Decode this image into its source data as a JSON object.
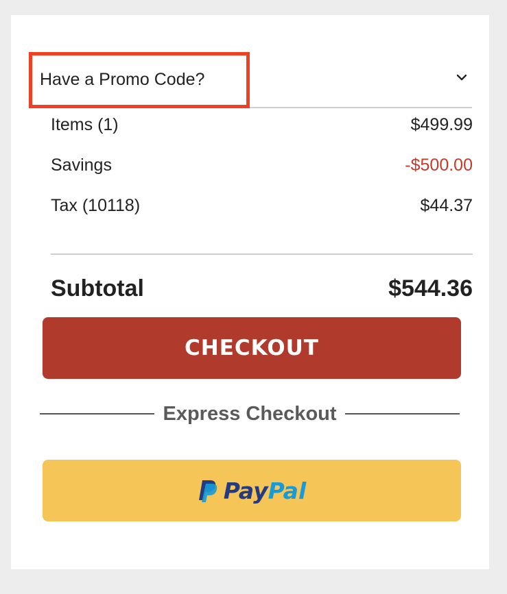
{
  "promo": {
    "label": "Have a Promo Code?",
    "icon": "chevron-down-icon"
  },
  "summary": {
    "items_label": "Items (1)",
    "items_value": "$499.99",
    "savings_label": "Savings",
    "savings_value": "-$500.00",
    "tax_label": "Tax (10118)",
    "tax_value": "$44.37"
  },
  "subtotal": {
    "label": "Subtotal",
    "value": "$544.36"
  },
  "checkout": {
    "label": "CHECKOUT"
  },
  "express": {
    "label": "Express Checkout"
  },
  "paypal": {
    "text_part1": "Pay",
    "text_part2": "Pal",
    "icon": "paypal-icon"
  },
  "colors": {
    "checkout_bg": "#b03a2c",
    "paypal_bg": "#f6c557",
    "savings_text": "#c33c2b",
    "highlight_box": "#ee4023"
  }
}
